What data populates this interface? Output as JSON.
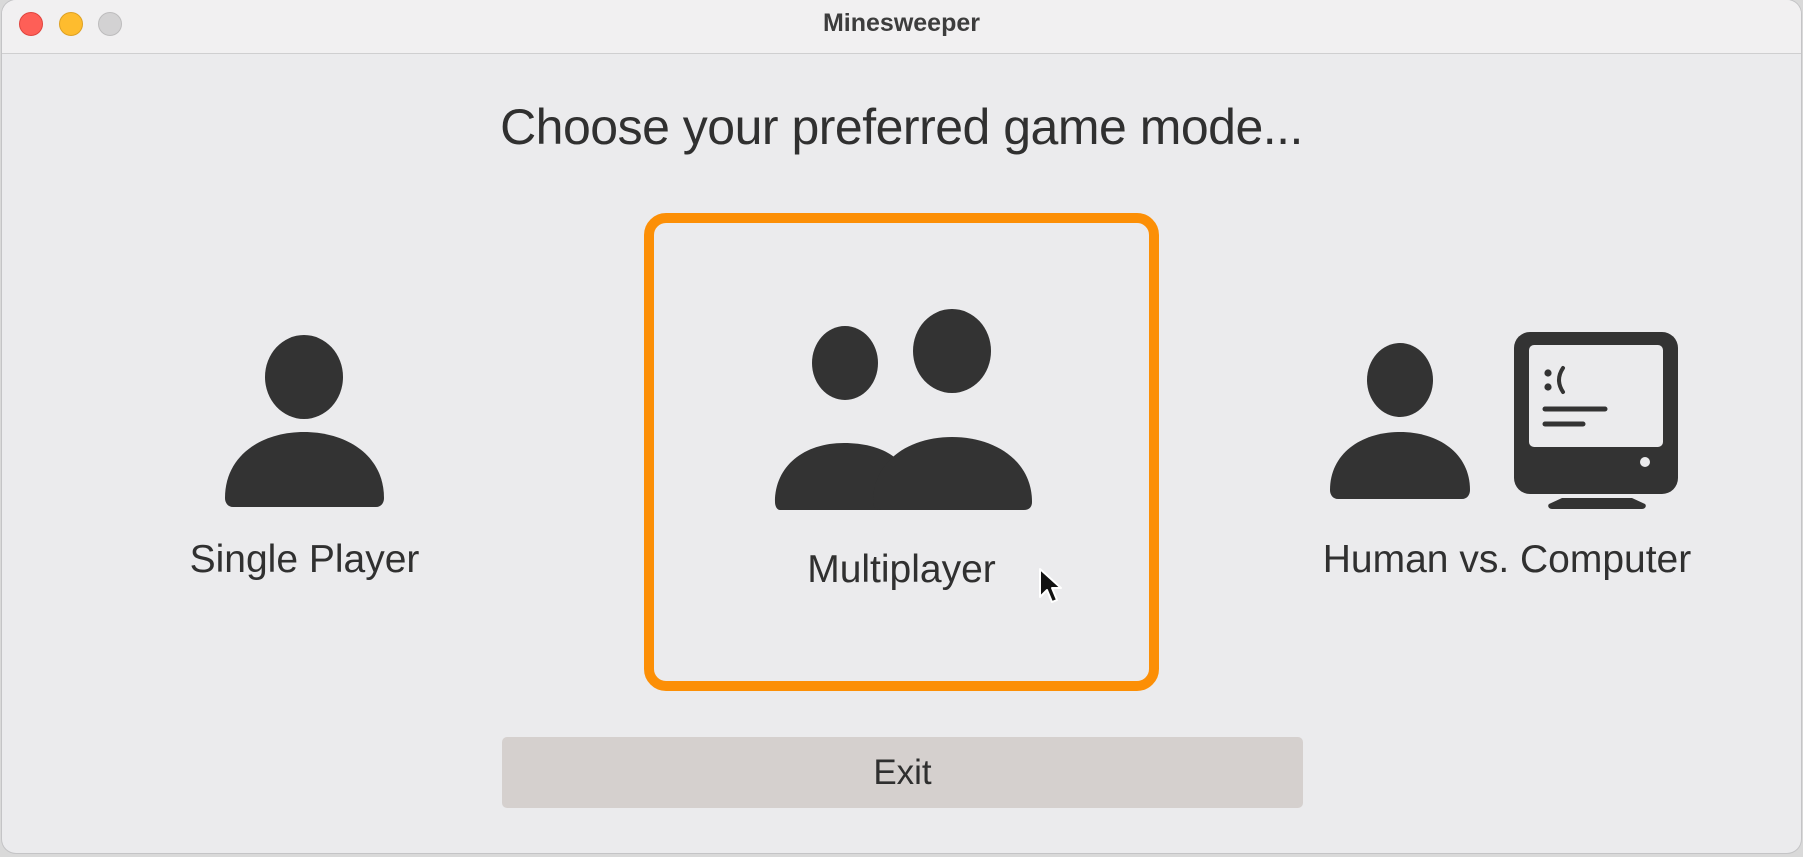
{
  "window": {
    "title": "Minesweeper"
  },
  "heading": "Choose your preferred game mode...",
  "modes": [
    {
      "label": "Single Player",
      "icon": "person-icon",
      "selected": false
    },
    {
      "label": "Multiplayer",
      "icon": "two-people-icon",
      "selected": true
    },
    {
      "label": "Human vs. Computer",
      "icon": "person-and-computer-icon",
      "selected": false
    }
  ],
  "exit_button": {
    "label": "Exit"
  },
  "colors": {
    "selection_border": "#fc8f06",
    "icon": "#333333",
    "button_bg": "#d5d0ce"
  }
}
